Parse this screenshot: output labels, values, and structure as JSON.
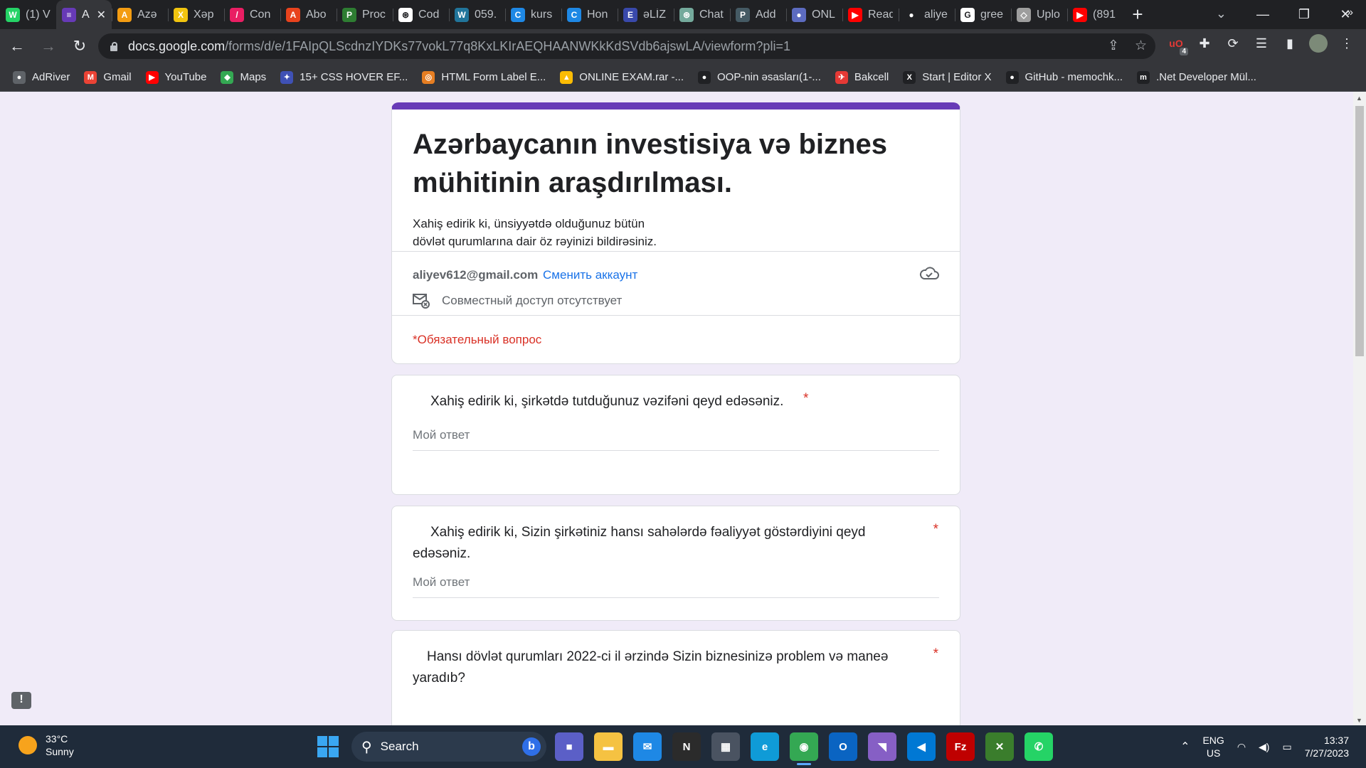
{
  "browser": {
    "tabs": [
      {
        "label": "(1) V",
        "icon": "whatsapp-icon",
        "color": "#25d366",
        "glyph": "W"
      },
      {
        "label": "A",
        "icon": "google-forms-icon",
        "color": "#673ab7",
        "glyph": "≡",
        "active": true
      },
      {
        "label": "Azə",
        "icon": "site-icon",
        "color": "#f39c12",
        "glyph": "A"
      },
      {
        "label": "Xəp",
        "icon": "site-icon",
        "color": "#f1c40f",
        "glyph": "X"
      },
      {
        "label": "Con",
        "icon": "site-icon",
        "color": "#e91e63",
        "glyph": "/"
      },
      {
        "label": "Abo",
        "icon": "site-icon",
        "color": "#e8431d",
        "glyph": "A"
      },
      {
        "label": "Proc",
        "icon": "site-icon",
        "color": "#2e7d32",
        "glyph": "P"
      },
      {
        "label": "Cod",
        "icon": "chatgpt-icon",
        "color": "#ffffff",
        "glyph": "⊛"
      },
      {
        "label": "059.",
        "icon": "wordpress-icon",
        "color": "#21759b",
        "glyph": "W"
      },
      {
        "label": "kurs",
        "icon": "site-icon",
        "color": "#1e88e5",
        "glyph": "C"
      },
      {
        "label": "Hon",
        "icon": "site-icon",
        "color": "#1e88e5",
        "glyph": "C"
      },
      {
        "label": "əLİZ",
        "icon": "site-icon",
        "color": "#3949ab",
        "glyph": "E"
      },
      {
        "label": "Chat",
        "icon": "chatgpt-icon",
        "color": "#74aa9c",
        "glyph": "⊛"
      },
      {
        "label": "Add",
        "icon": "site-icon",
        "color": "#455a64",
        "glyph": "P"
      },
      {
        "label": "ONL",
        "icon": "globe-icon",
        "color": "#5c6bc0",
        "glyph": "●"
      },
      {
        "label": "Read",
        "icon": "youtube-icon",
        "color": "#ff0000",
        "glyph": "▶"
      },
      {
        "label": "aliye",
        "icon": "github-icon",
        "color": "#202124",
        "glyph": "●"
      },
      {
        "label": "gree",
        "icon": "google-icon",
        "color": "#ffffff",
        "glyph": "G"
      },
      {
        "label": "Uplo",
        "icon": "upload-icon",
        "color": "#9e9e9e",
        "glyph": "◇"
      },
      {
        "label": "(891",
        "icon": "youtube-icon",
        "color": "#ff0000",
        "glyph": "▶"
      }
    ],
    "url_host": "docs.google.com",
    "url_path": "/forms/d/e/1FAIpQLScdnzIYDKs77vokL77q8KxLKIrAEQHAANWKkKdSVdb6ajswLA/viewform?pli=1",
    "extension_badge": "4",
    "bookmarks": [
      {
        "label": "AdRiver",
        "icon": "globe-icon",
        "color": "#5f6368",
        "glyph": "●"
      },
      {
        "label": "Gmail",
        "icon": "gmail-icon",
        "color": "#ea4335",
        "glyph": "M"
      },
      {
        "label": "YouTube",
        "icon": "youtube-icon",
        "color": "#ff0000",
        "glyph": "▶"
      },
      {
        "label": "Maps",
        "icon": "maps-icon",
        "color": "#34a853",
        "glyph": "◆"
      },
      {
        "label": "15+ CSS HOVER EF...",
        "icon": "site-icon",
        "color": "#3f51b5",
        "glyph": "✦"
      },
      {
        "label": "HTML Form Label E...",
        "icon": "globe-icon",
        "color": "#e67e22",
        "glyph": "◎"
      },
      {
        "label": "ONLINE EXAM.rar -...",
        "icon": "google-drive-icon",
        "color": "#fbbc04",
        "glyph": "▲"
      },
      {
        "label": "OOP-nin əsasları(1-...",
        "icon": "medium-icon",
        "color": "#202124",
        "glyph": "●"
      },
      {
        "label": "Bakcell",
        "icon": "bakcell-icon",
        "color": "#e53935",
        "glyph": "✈"
      },
      {
        "label": "Start | Editor X",
        "icon": "editor-x-icon",
        "color": "#202124",
        "glyph": "X"
      },
      {
        "label": "GitHub - memochk...",
        "icon": "github-icon",
        "color": "#202124",
        "glyph": "●"
      },
      {
        "label": ".Net Developer Mül...",
        "icon": "site-icon",
        "color": "#202124",
        "glyph": "m"
      }
    ]
  },
  "form": {
    "accent_color": "#673ab7",
    "title": "Azərbaycanın investisiya və biznes mühitinin araşdırılması.",
    "description_line1": "Xahiş edirik ki, ünsiyyətdə olduğunuz bütün",
    "description_line2": "dövlət qurumlarına dair öz rəyinizi bildirəsiniz.",
    "account_email": "aliyev612@gmail.com",
    "switch_account": "Сменить аккаунт",
    "sharing_status": "Совместный доступ отсутствует",
    "required_note": "*Обязательный вопрос",
    "questions": [
      {
        "text": "Xahiş edirik ki, şirkətdə tutduğunuz vəzifəni qeyd edəsəniz.",
        "required_mark": "*",
        "placeholder": "Мой ответ"
      },
      {
        "text": "Xahiş edirik ki, Sizin şirkətiniz hansı sahələrdə fəaliyyət göstərdiyini qeyd edəsəniz.",
        "required_mark": "*",
        "placeholder": "Мой ответ"
      },
      {
        "text": "Hansı dövlət qurumları 2022-ci il ərzində Sizin biznesinizə problem və maneə yaradıb?",
        "required_mark": "*"
      }
    ]
  },
  "taskbar": {
    "weather_temp": "33°C",
    "weather_desc": "Sunny",
    "search_label": "Search",
    "apps": [
      {
        "name": "teams-chat-icon",
        "color": "#5b5fc7",
        "glyph": "■",
        "running": false
      },
      {
        "name": "file-explorer-icon",
        "color": "#f5c242",
        "glyph": "▬",
        "running": false
      },
      {
        "name": "mail-icon",
        "color": "#1e88e5",
        "glyph": "✉",
        "running": false
      },
      {
        "name": "notion-icon",
        "color": "#2b2b2b",
        "glyph": "N",
        "running": false
      },
      {
        "name": "calculator-icon",
        "color": "#4a5361",
        "glyph": "▦",
        "running": false
      },
      {
        "name": "edge-icon",
        "color": "#0f9bd7",
        "glyph": "e",
        "running": false
      },
      {
        "name": "chrome-icon",
        "color": "#34a853",
        "glyph": "◉",
        "running": true,
        "active": true
      },
      {
        "name": "outlook-icon",
        "color": "#0a64c2",
        "glyph": "O",
        "running": false
      },
      {
        "name": "visual-studio-icon",
        "color": "#865fc5",
        "glyph": "◥",
        "running": false
      },
      {
        "name": "vscode-icon",
        "color": "#0078d4",
        "glyph": "◀",
        "running": false
      },
      {
        "name": "filezilla-icon",
        "color": "#bf0000",
        "glyph": "Fz",
        "running": false
      },
      {
        "name": "excel-tool-icon",
        "color": "#3a7d2c",
        "glyph": "✕",
        "running": false
      },
      {
        "name": "whatsapp-icon",
        "color": "#25d366",
        "glyph": "✆",
        "running": false
      }
    ],
    "lang_top": "ENG",
    "lang_bottom": "US",
    "time": "13:37",
    "date": "7/27/2023"
  }
}
